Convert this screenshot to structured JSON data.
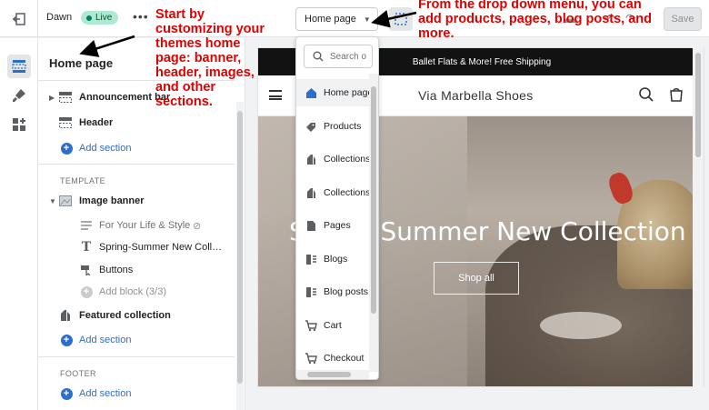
{
  "topbar": {
    "theme_name": "Dawn",
    "live_badge": "Live",
    "more": "•••",
    "page_select": "Home page",
    "save": "Save"
  },
  "sidebar": {
    "title": "Home page",
    "header_sections": [
      {
        "label": "Announcement bar",
        "icon": "layout-section-icon"
      },
      {
        "label": "Header",
        "icon": "layout-section-icon"
      }
    ],
    "add_section": "Add section",
    "template_heading": "TEMPLATE",
    "image_banner": "Image banner",
    "blocks": [
      {
        "label": "For Your Life & Style",
        "icon": "paragraph-icon"
      },
      {
        "label": "Spring-Summer New Collec…",
        "icon": "heading-icon"
      },
      {
        "label": "Buttons",
        "icon": "button-icon"
      }
    ],
    "add_block": "Add block (3/3)",
    "featured_collection": "Featured collection",
    "footer_heading": "FOOTER"
  },
  "dropdown": {
    "search_placeholder": "Search o",
    "items": [
      {
        "label": "Home page",
        "icon": "home-icon",
        "selected": true
      },
      {
        "label": "Products",
        "icon": "tag-icon",
        "selected": false
      },
      {
        "label": "Collections",
        "icon": "collection-icon",
        "selected": false
      },
      {
        "label": "Collections",
        "icon": "collection-icon",
        "selected": false
      },
      {
        "label": "Pages",
        "icon": "page-icon",
        "selected": false
      },
      {
        "label": "Blogs",
        "icon": "blog-icon",
        "selected": false
      },
      {
        "label": "Blog posts",
        "icon": "blog-icon",
        "selected": false
      },
      {
        "label": "Cart",
        "icon": "cart-icon",
        "selected": false
      },
      {
        "label": "Checkout",
        "icon": "cart-icon",
        "selected": false
      }
    ]
  },
  "preview": {
    "announcement": "Ballet Flats & More! Free Shipping",
    "store_name": "Via Marbella Shoes",
    "hero_heading": "Spring-Summer New Collection",
    "shop_all": "Shop all"
  },
  "annotations": {
    "left": "Start by customizing your themes home page: banner, header, images, and other sections.",
    "right": "From the drop down menu, you can add products, pages, blog posts, and more."
  },
  "colors": {
    "accent_blue": "#2c6ecb",
    "annotation_red": "#e00000",
    "live_green": "#aee9d1"
  }
}
